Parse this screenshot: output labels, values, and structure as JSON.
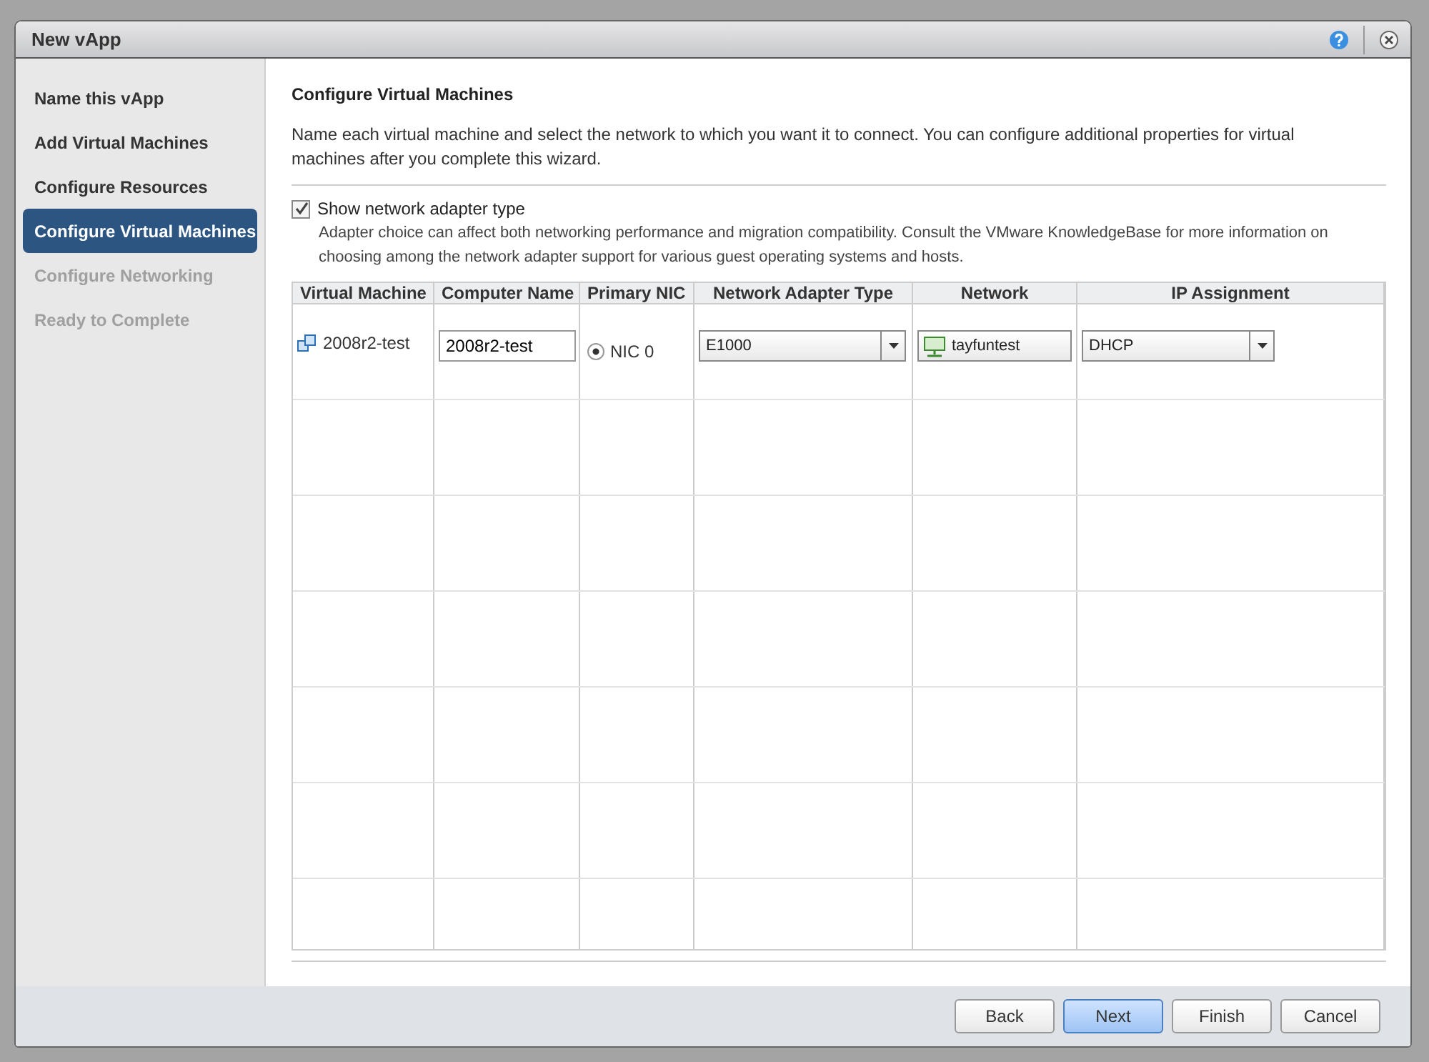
{
  "window": {
    "title": "New vApp"
  },
  "steps": [
    {
      "label": "Name this vApp",
      "selected": false,
      "disabled": false
    },
    {
      "label": "Add Virtual Machines",
      "selected": false,
      "disabled": false
    },
    {
      "label": "Configure Resources",
      "selected": false,
      "disabled": false
    },
    {
      "label": "Configure Virtual Machines",
      "selected": true,
      "disabled": false
    },
    {
      "label": "Configure Networking",
      "selected": false,
      "disabled": true
    },
    {
      "label": "Ready to Complete",
      "selected": false,
      "disabled": true
    }
  ],
  "page": {
    "heading": "Configure Virtual Machines",
    "description": "Name each virtual machine and select the network to which you want it to connect. You can configure additional properties for virtual machines after you complete this wizard."
  },
  "show_adapter": {
    "label": "Show network adapter type",
    "checked": true,
    "note": "Adapter choice can affect both networking performance and migration compatibility. Consult the VMware KnowledgeBase for more information on choosing among the network adapter support for various guest operating systems and hosts."
  },
  "table": {
    "columns": [
      "Virtual Machine",
      "Computer Name",
      "Primary NIC",
      "Network Adapter Type",
      "Network",
      "IP Assignment"
    ],
    "rows": [
      {
        "vm": "2008r2-test",
        "computer_name": "2008r2-test",
        "nic": "NIC 0",
        "nic_selected": true,
        "adapter_type": "E1000",
        "network": "tayfuntest",
        "ip_assignment": "DHCP"
      }
    ]
  },
  "buttons": [
    {
      "label": "Back",
      "default": false
    },
    {
      "label": "Next",
      "default": true
    },
    {
      "label": "Finish",
      "default": false
    },
    {
      "label": "Cancel",
      "default": false
    }
  ]
}
